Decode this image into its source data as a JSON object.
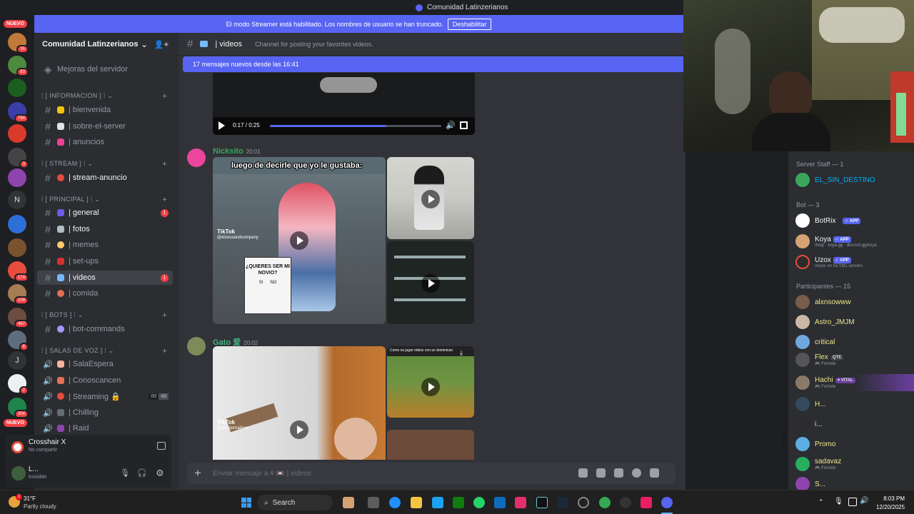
{
  "window": {
    "title": "Comunidad Latinzerianos"
  },
  "banner": {
    "text": "El modo Streamer está habilitado. Los nombres de usuario se han truncado.",
    "button": "Deshabilitar"
  },
  "rail": {
    "top_pill": "NUEVO",
    "bottom_pill": "NUEVO",
    "badges": [
      "35",
      "63",
      "794",
      "3",
      "174",
      "109",
      "467",
      "6",
      "2",
      "304"
    ],
    "letters": [
      "N",
      "J"
    ]
  },
  "guild": {
    "name": "Comunidad Latinzerianos"
  },
  "sidebar": {
    "boost": "Mejoras del servidor",
    "categories": {
      "info": "⁞ [ INFORMACION ] ⁞",
      "stream": "⁞ [ STREAM ] ⁞",
      "principal": "⁞ [ PRINCIPAL ] ⁞",
      "bots": "⁞ [ BOTS ] ⁞",
      "voz": "⁞ [ SALAS DE VOZ ] ⁞"
    },
    "channels": {
      "bienvenida": "| bienvenida",
      "sobre": "| sobre-el-server",
      "anuncios": "| anuncios",
      "stream": "| stream-anuncio",
      "general": "| general",
      "fotos": "| fotos",
      "memes": "| memes",
      "setups": "| set-ups",
      "videos": "| videos",
      "comida": "| comida",
      "botcmd": "| bot-commands",
      "sala": "| SalaEspera",
      "conoscancen": "| Conoscancen",
      "streaming": "| Streaming 🔒",
      "chilling": "| Chilling",
      "raid": "| Raid"
    },
    "general_badge": "1",
    "videos_badge": "1",
    "streaming_count": [
      "00",
      "48"
    ]
  },
  "share": {
    "title": "Crosshair X",
    "subtitle": "No compartir"
  },
  "user": {
    "name": "L...",
    "status": "Invisible"
  },
  "chat": {
    "channel": "| videos",
    "topic": "Channel for posting your favorites videos.",
    "new_messages": "17 mensajes nuevos desde las 16:41",
    "player_time": "0:17 / 0:25",
    "composer_placeholder": "Enviar mensaje a # 📼 | videos",
    "messages": [
      {
        "author": "Nicksito",
        "time": "20:01",
        "caption": "luego de decirle que yo le gustaba:",
        "sign": "¿QUIERES SER MI NOVIO?",
        "sign_opts": "SI      NO",
        "tiktok": "TikTok",
        "handle": "@elzeusandcompany"
      },
      {
        "author": "Gato 爱",
        "time": "20:02",
        "tiktok": "TikTok",
        "handle": "@elviejomailooo",
        "caption2": "Como es jugar roblox con un dominican"
      }
    ]
  },
  "members": {
    "staff_header": "Server Staff — 1",
    "bot_header": "Bot — 3",
    "participants_header": "Participantes — 15",
    "staff": [
      {
        "name": "EL_SIN_DESTINO"
      }
    ],
    "bots": [
      {
        "name": "BotRix",
        "tag": "✓ APP",
        "sub": ""
      },
      {
        "name": "Koya",
        "tag": "✓ APP",
        "sub": "/help · koya.gg · discord.gg/koya"
      },
      {
        "name": "Uzox",
        "tag": "✓ APP",
        "sub": "music on 517091 servers"
      }
    ],
    "participants": [
      {
        "name": "alxnsowww",
        "sub": "",
        "tag": ""
      },
      {
        "name": "Astro_JMJM",
        "sub": "",
        "tag": ""
      },
      {
        "name": "critical",
        "sub": "",
        "tag": ""
      },
      {
        "name": "Flex",
        "sub": "🎮 Fortnite",
        "tag": "QTE"
      },
      {
        "name": "Hachi",
        "sub": "🎮 Fortnite",
        "tag": "♥ VITAL"
      },
      {
        "name": "H...",
        "sub": "",
        "tag": ""
      },
      {
        "name": "i...",
        "sub": "",
        "tag": ""
      },
      {
        "name": "Promo",
        "sub": "",
        "tag": ""
      },
      {
        "name": "sadavaz",
        "sub": "🎮 Fortnite",
        "tag": ""
      },
      {
        "name": "S...",
        "sub": "",
        "tag": ""
      }
    ]
  },
  "taskbar": {
    "weather_temp": "31°F",
    "weather_desc": "Partly cloudy",
    "weather_badge": "2",
    "search": "Search",
    "time": "8:03 PM",
    "date": "12/20/2025"
  }
}
